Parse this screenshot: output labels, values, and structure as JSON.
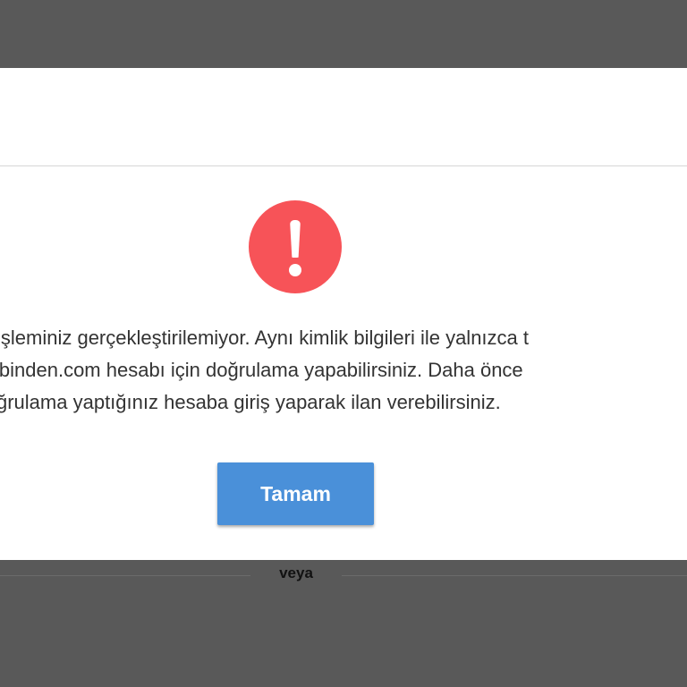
{
  "dialog": {
    "message_lines": [
      "işleminiz gerçekleştirilemiyor. Aynı kimlik bilgileri ile yalnızca t",
      "ibinden.com hesabı için doğrulama yapabilirsiniz. Daha önce",
      "ğrulama yaptığınız hesaba giriş yaparak ilan verebilirsiniz."
    ],
    "ok_button_label": "Tamam",
    "icon": "exclamation-icon",
    "icon_color": "#f75358",
    "button_color": "#4a90d9"
  },
  "background": {
    "separator_text": "veya"
  }
}
